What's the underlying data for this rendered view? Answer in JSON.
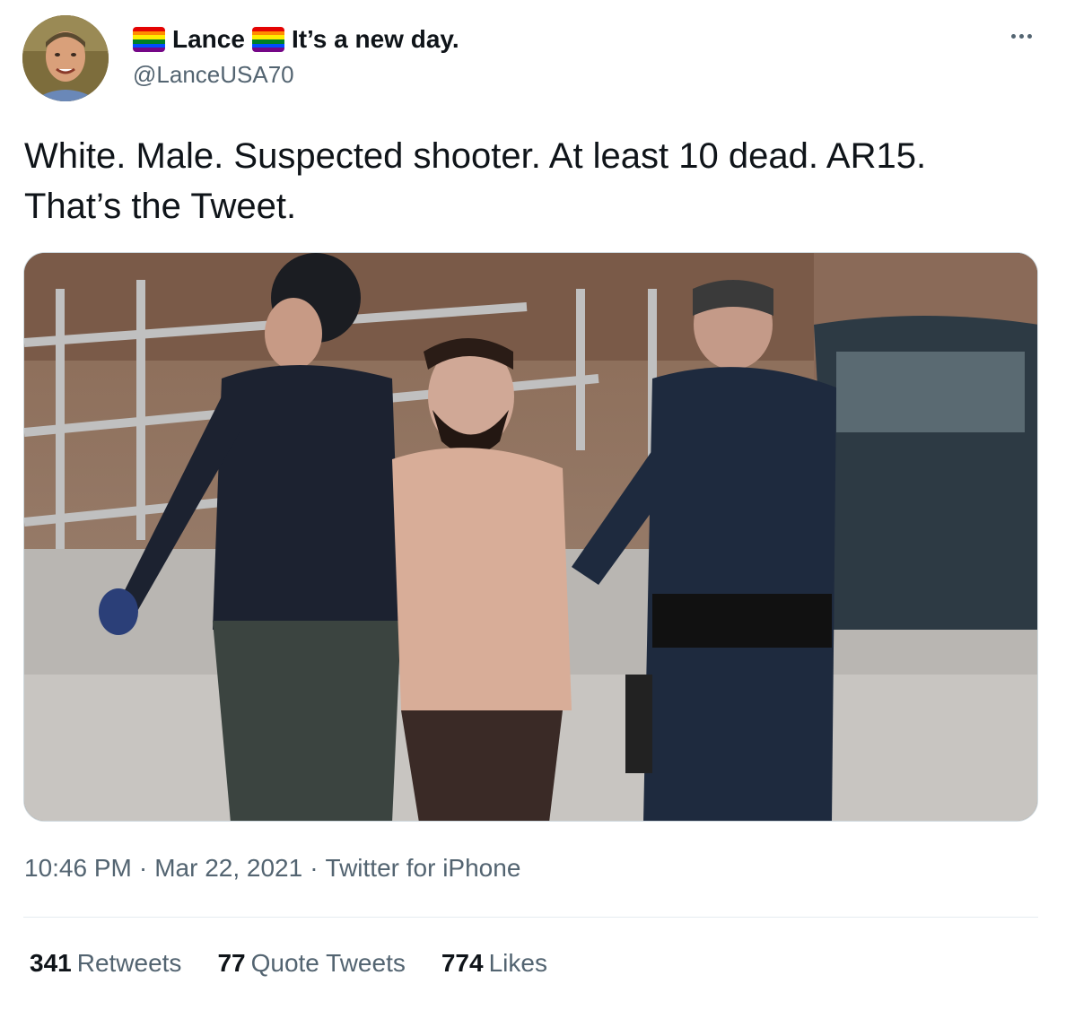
{
  "tweet": {
    "author": {
      "display_name_part1": "Lance",
      "display_name_part2": "It’s a new day.",
      "handle": "@LanceUSA70",
      "flag_icon": "rainbow-flag-emoji"
    },
    "text_lines": [
      "White. Male. Suspected shooter. At least 10 dead. AR15.",
      "That’s the Tweet."
    ],
    "time": "10:46 PM",
    "date": "Mar 22, 2021",
    "source": "Twitter for iPhone",
    "separator": "·",
    "stats": {
      "retweets_count": "341",
      "retweets_label": "Retweets",
      "quotes_count": "77",
      "quotes_label": "Quote Tweets",
      "likes_count": "774",
      "likes_label": "Likes"
    },
    "more_icon": "ellipsis-icon"
  },
  "colors": {
    "text_primary": "#0f1419",
    "text_secondary": "#536471",
    "divider": "#e6ecf0",
    "rainbow": [
      "#e40303",
      "#ff8c00",
      "#ffed00",
      "#008026",
      "#004dff",
      "#750787"
    ]
  }
}
